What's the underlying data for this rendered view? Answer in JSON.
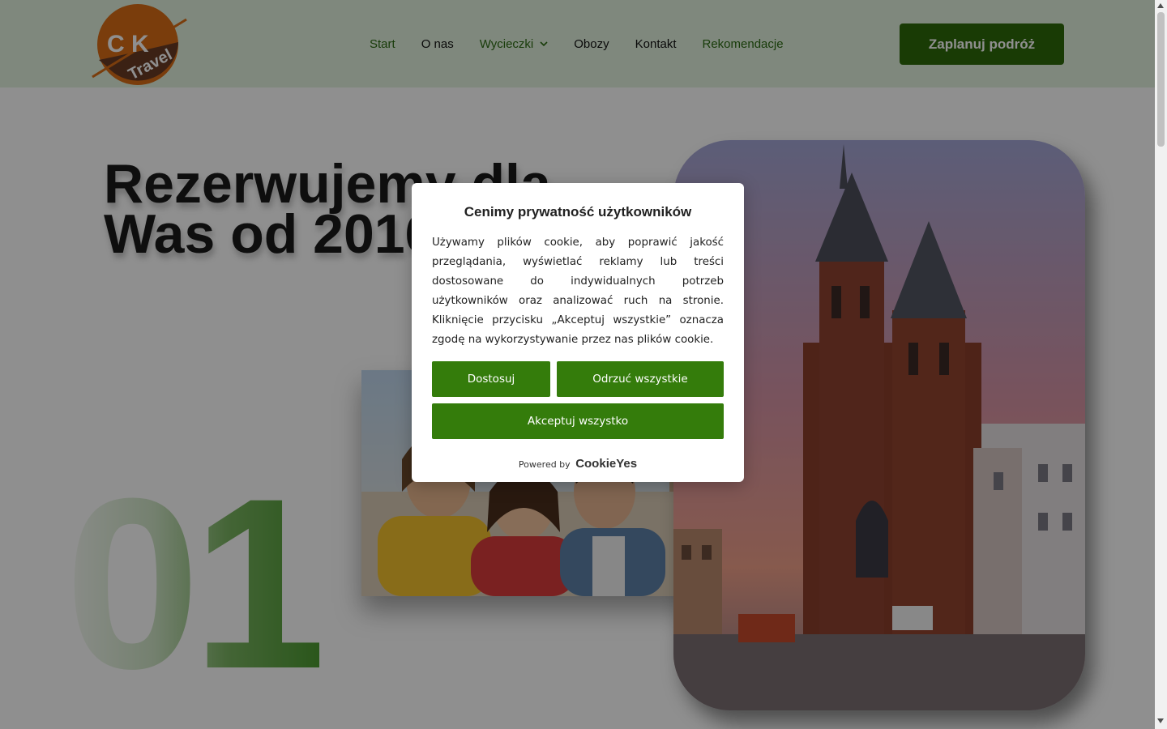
{
  "header": {
    "logo": {
      "line1": "C K",
      "line2": "Travel"
    },
    "nav": [
      {
        "label": "Start"
      },
      {
        "label": "O nas"
      },
      {
        "label": "Wycieczki"
      },
      {
        "label": "Obozy"
      },
      {
        "label": "Kontakt"
      },
      {
        "label": "Rekomendacje"
      }
    ],
    "cta_label": "Zaplanuj podróż"
  },
  "hero": {
    "title_line1": "Rezerwujemy dla",
    "title_line2": "Was od 2016",
    "big_number": "01"
  },
  "cookie_modal": {
    "title": "Cenimy prywatność użytkowników",
    "text": "Używamy plików cookie, aby poprawić jakość przeglądania, wyświetlać reklamy lub treści dostosowane do indywidualnych potrzeb użytkowników oraz analizować ruch na stronie. Kliknięcie przycisku „Akceptuj wszystkie” oznacza zgodę na wykorzystywanie przez nas plików cookie.",
    "customize_label": "Dostosuj",
    "reject_label": "Odrzuć wszystkie",
    "accept_label": "Akceptuj wszystko",
    "powered_by": "Powered by",
    "brand": "CookieYes"
  },
  "colors": {
    "brand_green": "#347c0b",
    "header_bg": "#e3f2df",
    "logo_orange": "#d96e16",
    "logo_brown": "#6a3c24"
  }
}
